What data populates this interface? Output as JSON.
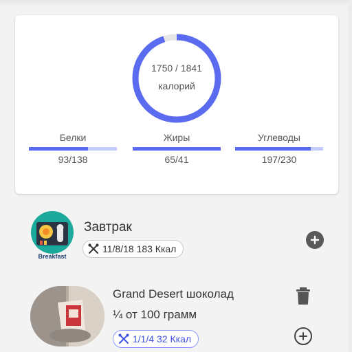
{
  "summary": {
    "calories": {
      "consumed": 1750,
      "goal": 1841,
      "label": "1750 / 1841",
      "unit": "калорий"
    },
    "macros": [
      {
        "name": "Белки",
        "value": "93/138",
        "progress": 0.67
      },
      {
        "name": "Жиры",
        "value": "65/41",
        "progress": 1.0
      },
      {
        "name": "Углеводы",
        "value": "197/230",
        "progress": 0.86
      }
    ]
  },
  "meal": {
    "title": "Завтрак",
    "logo_text": "Breakfast",
    "chip": "11/8/18 183 Ккал"
  },
  "food": {
    "name": "Grand Desert шоколад",
    "portion": "¼ от 100 грамм",
    "chip": "1/1/4 32 Ккал"
  },
  "colors": {
    "accent": "#5b6bf0",
    "accent_light": "#c5ccff",
    "chip_blue": "#3f52e0"
  },
  "icons": [
    "cutlery-icon",
    "add-circle-icon",
    "add-outline-icon",
    "trash-icon"
  ]
}
